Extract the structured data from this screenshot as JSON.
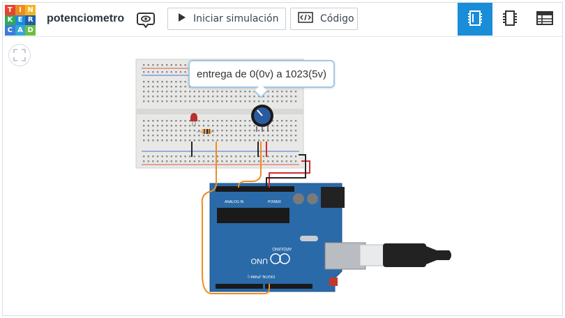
{
  "logo": {
    "letters": [
      "T",
      "I",
      "N",
      "K",
      "E",
      "R",
      "C",
      "A",
      "D"
    ],
    "colors": [
      "#e8432e",
      "#f28a1f",
      "#f5b425",
      "#35a853",
      "#1a8dd8",
      "#1d5fa8",
      "#3b7dd8",
      "#33a6d9",
      "#6dbd45"
    ]
  },
  "project": {
    "title": "potenciometro"
  },
  "toolbar": {
    "visibility_icon": "eye-bubble-icon",
    "simulate_label": "Iniciar simulación",
    "simulate_icon": "play-icon",
    "code_label": "Código",
    "code_icon": "code-icon"
  },
  "view_tabs": [
    {
      "icon": "circuit-view-icon",
      "active": true
    },
    {
      "icon": "schematic-view-icon",
      "active": false
    },
    {
      "icon": "component-list-icon",
      "active": false
    }
  ],
  "canvas": {
    "fit_icon": "fit-view-icon",
    "annotation": "entrega de 0(0v) a 1023(5v)"
  },
  "board": {
    "brand": "ARDUINO",
    "model": "UNO",
    "header_digital": "DIGITAL (PWM~)",
    "header_power": "POWER",
    "header_analog": "ANALOG IN"
  },
  "colors": {
    "accent": "#1a8dd8",
    "board_blue": "#2a6aa8",
    "wire_orange": "#f08c1e",
    "wire_red": "#d42a2a",
    "wire_black": "#222222"
  }
}
